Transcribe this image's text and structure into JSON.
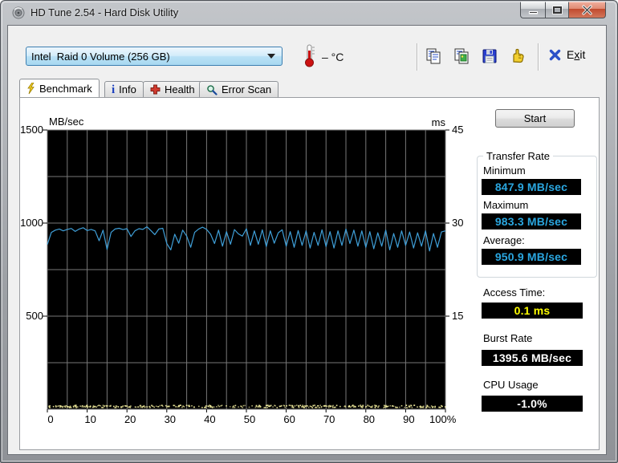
{
  "window": {
    "title": "HD Tune 2.54 - Hard Disk Utility",
    "controls": {
      "minimize": "minimize",
      "maximize": "maximize",
      "close": "close"
    }
  },
  "toolbar": {
    "drive_select": "Intel  Raid 0 Volume (256 GB)",
    "temperature_display": "– °C",
    "icons": [
      "copy-icon",
      "copy-image-icon",
      "save-icon",
      "options-icon"
    ],
    "exit_e": "E",
    "exit_x": "x",
    "exit_rest": "it"
  },
  "tabs": [
    {
      "label": "Benchmark",
      "active": true,
      "icon": "benchmark-lightning-icon"
    },
    {
      "label": "Info",
      "active": false,
      "icon": "info-icon"
    },
    {
      "label": "Health",
      "active": false,
      "icon": "health-cross-icon"
    },
    {
      "label": "Error Scan",
      "active": false,
      "icon": "error-scan-magnifier-icon"
    }
  ],
  "results": {
    "start_label": "Start",
    "transfer_rate": {
      "group_label": "Transfer Rate",
      "minimum_label": "Minimum",
      "minimum_value": "847.9 MB/sec",
      "maximum_label": "Maximum",
      "maximum_value": "983.3 MB/sec",
      "average_label": "Average:",
      "average_value": "950.9 MB/sec"
    },
    "access_time": {
      "label": "Access Time:",
      "value": "0.1 ms"
    },
    "burst_rate": {
      "label": "Burst Rate",
      "value": "1395.6 MB/sec"
    },
    "cpu_usage": {
      "label": "CPU Usage",
      "value": "-1.0%"
    }
  },
  "colors": {
    "accent_cyan": "#2aa6df",
    "value_yellow": "#ffff00",
    "value_white": "#ffffff",
    "chart_bg": "#000000",
    "grid": "#787878",
    "transfer_line": "#3f9fd8",
    "access_dots": "#f6f1a0"
  },
  "chart_data": {
    "type": "line",
    "title": "",
    "ylabel_left": "MB/sec",
    "ylabel_right": "ms",
    "ylim_left": [
      0,
      1500
    ],
    "ylim_right": [
      0,
      45
    ],
    "left_ticks": [
      1500,
      1000,
      500
    ],
    "right_ticks": [
      45,
      30,
      15
    ],
    "x_ticks": [
      "0",
      "10",
      "20",
      "30",
      "40",
      "50",
      "60",
      "70",
      "80",
      "90",
      "100%"
    ],
    "xlim": [
      0,
      100
    ],
    "grid": true,
    "grid_x_step": 5,
    "grid_y_step": 250,
    "legend": "none",
    "series": [
      {
        "name": "transfer-rate-mbsec",
        "axis": "left",
        "color": "#3f9fd8",
        "x_step": 1,
        "values": [
          885,
          950,
          962,
          968,
          958,
          966,
          971,
          955,
          968,
          975,
          960,
          966,
          958,
          905,
          962,
          858,
          950,
          968,
          972,
          965,
          970,
          928,
          958,
          970,
          966,
          980,
          960,
          938,
          968,
          972,
          890,
          856,
          940,
          892,
          962,
          930,
          870,
          950,
          968,
          978,
          966,
          940,
          890,
          962,
          876,
          954,
          886,
          965,
          942,
          930,
          970,
          880,
          958,
          886,
          964,
          874,
          958,
          892,
          948,
          964,
          876,
          954,
          870,
          960,
          880,
          958,
          866,
          950,
          880,
          964,
          874,
          954,
          866,
          958,
          880,
          968,
          890,
          962,
          876,
          958,
          870,
          954,
          862,
          948,
          876,
          962,
          856,
          944,
          870,
          958,
          880,
          952,
          866,
          948,
          876,
          958,
          850,
          944,
          870,
          952,
          958
        ]
      },
      {
        "name": "access-time-ms",
        "axis": "right",
        "style": "dots",
        "color": "#f6f1a0",
        "value_ms": 0.1
      }
    ]
  }
}
